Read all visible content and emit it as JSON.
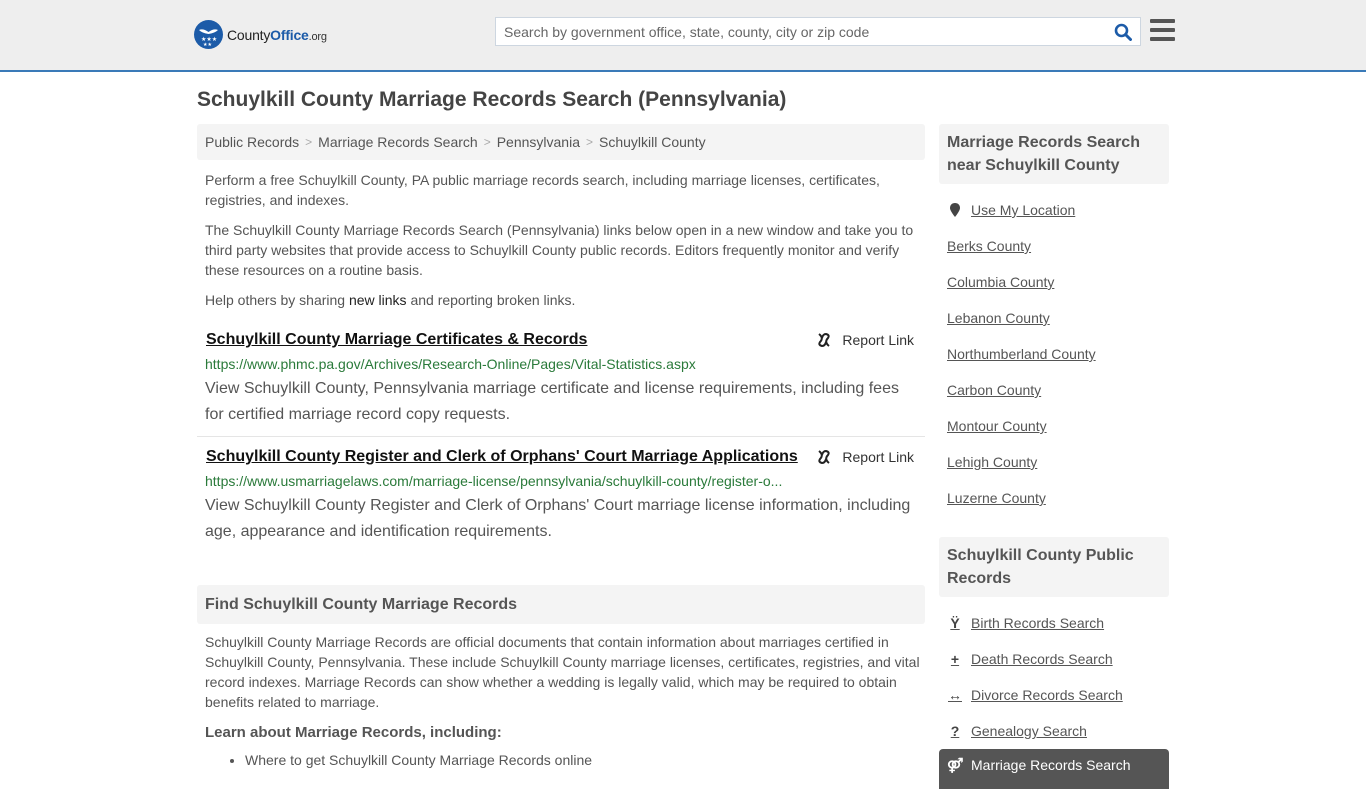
{
  "header": {
    "logo": {
      "part1": "County",
      "part2": "Office",
      "part3": ".org"
    },
    "search": {
      "placeholder": "Search by government office, state, county, city or zip code",
      "value": ""
    },
    "colors": {
      "brand": "#1c5ba8",
      "accent_border": "#3a7ab8"
    }
  },
  "main": {
    "title": "Schuylkill County Marriage Records Search (Pennsylvania)",
    "breadcrumb": [
      "Public Records",
      "Marriage Records Search",
      "Pennsylvania",
      "Schuylkill County"
    ],
    "intro": {
      "p1": "Perform a free Schuylkill County, PA public marriage records search, including marriage licenses, certificates, registries, and indexes.",
      "p2": "The Schuylkill County Marriage Records Search (Pennsylvania) links below open in a new window and take you to third party websites that provide access to Schuylkill County public records. Editors frequently monitor and verify these resources on a routine basis.",
      "p3_before": "Help others by sharing ",
      "p3_link": "new links",
      "p3_after": " and reporting broken links."
    },
    "results": [
      {
        "title": "Schuylkill County Marriage Certificates & Records",
        "url": "https://www.phmc.pa.gov/Archives/Research-Online/Pages/Vital-Statistics.aspx",
        "description": "View Schuylkill County, Pennsylvania marriage certificate and license requirements, including fees for certified marriage record copy requests.",
        "report_label": "Report Link"
      },
      {
        "title": "Schuylkill County Register and Clerk of Orphans' Court Marriage Applications",
        "url": "https://www.usmarriagelaws.com/marriage-license/pennsylvania/schuylkill-county/register-o...",
        "description": "View Schuylkill County Register and Clerk of Orphans' Court marriage license information, including age, appearance and identification requirements.",
        "report_label": "Report Link"
      }
    ],
    "find_section": {
      "heading": "Find Schuylkill County Marriage Records",
      "body": "Schuylkill County Marriage Records are official documents that contain information about marriages certified in Schuylkill County, Pennsylvania. These include Schuylkill County marriage licenses, certificates, registries, and vital record indexes. Marriage Records can show whether a wedding is legally valid, which may be required to obtain benefits related to marriage.",
      "learn_heading": "Learn about Marriage Records, including:",
      "learn_items": [
        "Where to get Schuylkill County Marriage Records online"
      ]
    }
  },
  "sidebar": {
    "nearby": {
      "heading": "Marriage Records Search near Schuylkill County",
      "use_location": "Use My Location",
      "counties": [
        "Berks County",
        "Columbia County",
        "Lebanon County",
        "Northumberland County",
        "Carbon County",
        "Montour County",
        "Lehigh County",
        "Luzerne County"
      ]
    },
    "public_records": {
      "heading": "Schuylkill County Public Records",
      "items": [
        {
          "label": "Birth Records Search",
          "icon": "child-icon"
        },
        {
          "label": "Death Records Search",
          "icon": "plus-icon"
        },
        {
          "label": "Divorce Records Search",
          "icon": "arrows-horizontal-icon"
        },
        {
          "label": "Genealogy Search",
          "icon": "question-icon"
        },
        {
          "label": "Marriage Records Search",
          "icon": "genderless-rings-icon",
          "active": true
        }
      ]
    }
  }
}
